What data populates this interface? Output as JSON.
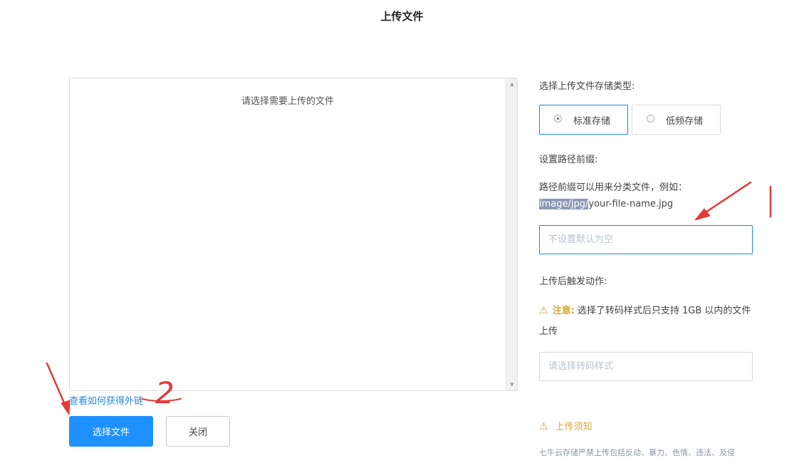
{
  "page": {
    "title": "上传文件"
  },
  "filebox": {
    "hint": "请选择需要上传的文件"
  },
  "links": {
    "external": "查看如何获得外链"
  },
  "buttons": {
    "select": "选择文件",
    "close": "关闭"
  },
  "storage": {
    "label": "选择上传文件存储类型:",
    "options": [
      {
        "label": "标准存储",
        "selected": true
      },
      {
        "label": "低频存储",
        "selected": false
      }
    ]
  },
  "prefix": {
    "label": "设置路径前缀:",
    "desc_line1": "路径前缀可以用来分类文件，例如：",
    "example_highlight": "image/jpg/",
    "example_rest": "your-file-name.jpg",
    "placeholder": "不设置默认为空",
    "value": ""
  },
  "trigger": {
    "label": "上传后触发动作:",
    "notice_label": "注意:",
    "notice_text": "选择了转码样式后只支持 1GB 以内的文件上传",
    "select_placeholder": "请选择转码样式"
  },
  "upload_notice": {
    "title": "上传须知",
    "body": "七牛云存储严禁上传包括反动、暴力、色情、违法、及侵"
  },
  "annotation": {
    "number": "2",
    "color": "#e53935"
  },
  "colors": {
    "primary": "#1e90ff",
    "link": "#1e88e5",
    "warning": "#d4a53b"
  }
}
